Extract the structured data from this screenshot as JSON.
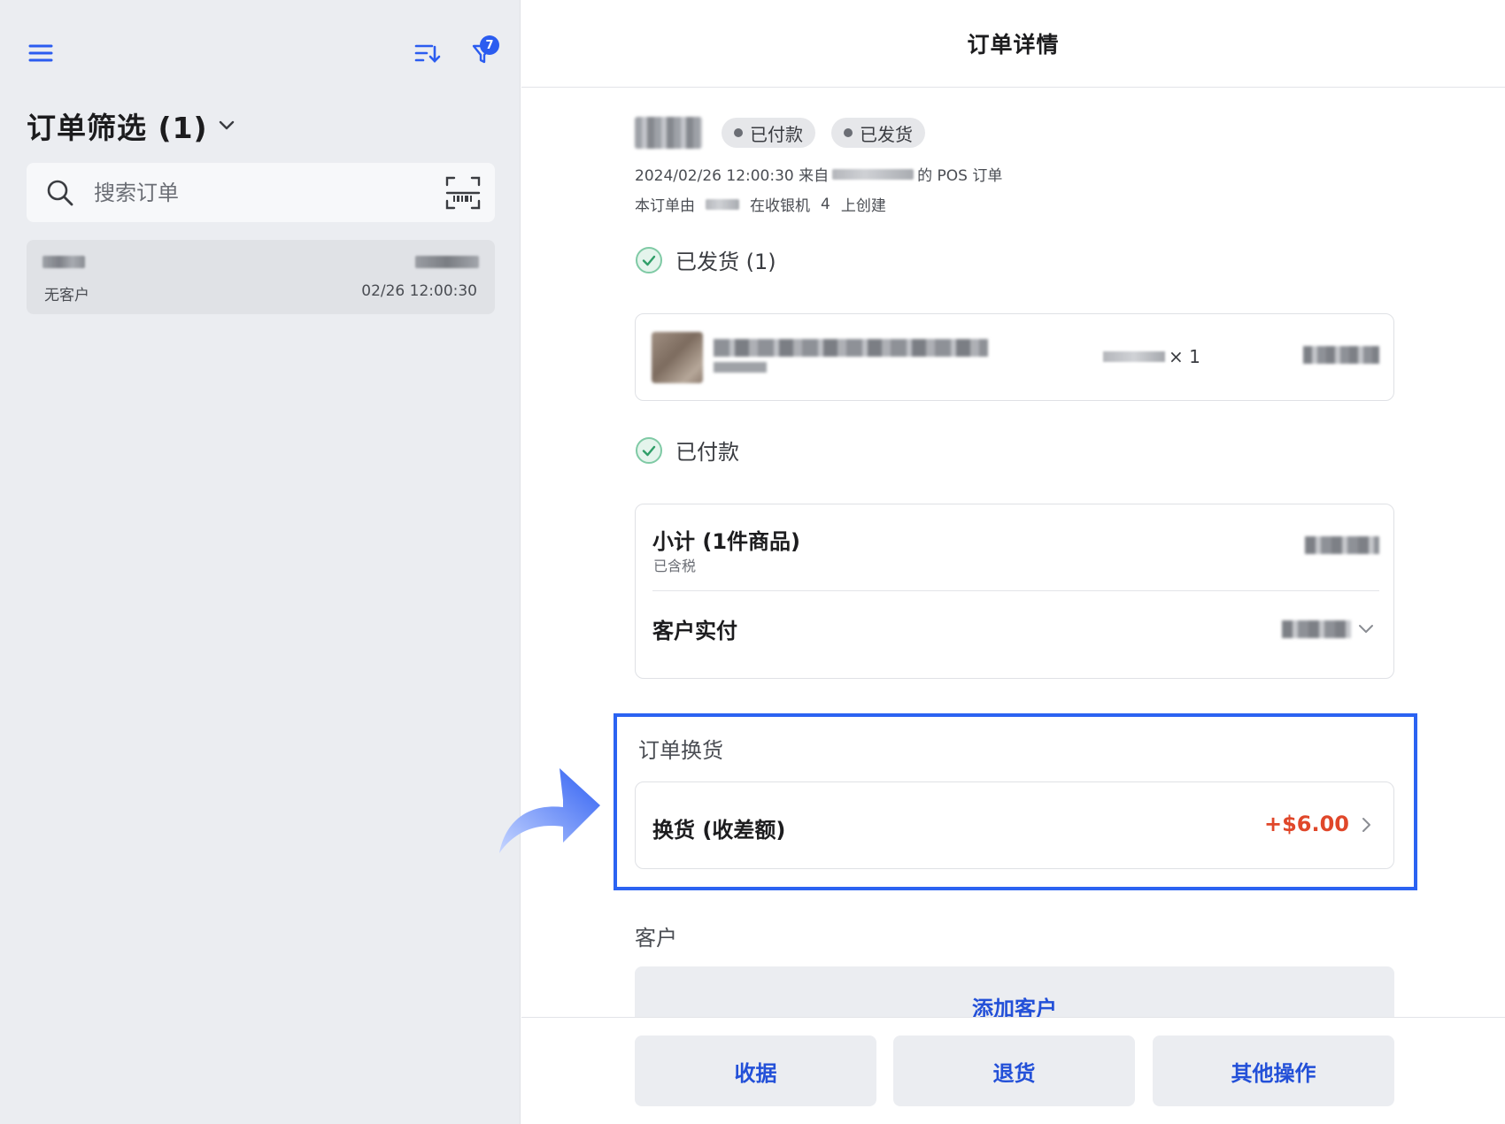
{
  "colors": {
    "accent": "#2b5cf0",
    "highlight_border": "#2b63f2",
    "amount_red": "#e0472a",
    "success_green": "#3fae7a"
  },
  "sidebar": {
    "filter_badge": "7",
    "filter_title": "订单筛选 (1)",
    "search": {
      "placeholder": "搜索订单"
    },
    "orders": [
      {
        "customer": "无客户",
        "time": "02/26 12:00:30"
      }
    ]
  },
  "detail": {
    "title": "订单详情",
    "status_badges": [
      "已付款",
      "已发货"
    ],
    "meta": {
      "date_prefix": "2024/02/26 12:00:30 来自",
      "date_suffix": "的 POS 订单",
      "created_prefix": "本订单由",
      "created_register": "在收银机",
      "register_no": "4",
      "created_suffix": "上创建"
    },
    "shipped": {
      "title": "已发货 (1)",
      "item_qty": "× 1"
    },
    "paid": {
      "title": "已付款",
      "subtotal_label": "小计 (1件商品)",
      "tax_note": "已含税",
      "customer_paid_label": "客户实付"
    },
    "exchange": {
      "title": "订单换货",
      "label": "换货 (收差额)",
      "amount": "+$6.00"
    },
    "customer": {
      "title": "客户",
      "add_button": "添加客户"
    },
    "actions": {
      "receipt": "收据",
      "return": "退货",
      "more": "其他操作"
    }
  }
}
